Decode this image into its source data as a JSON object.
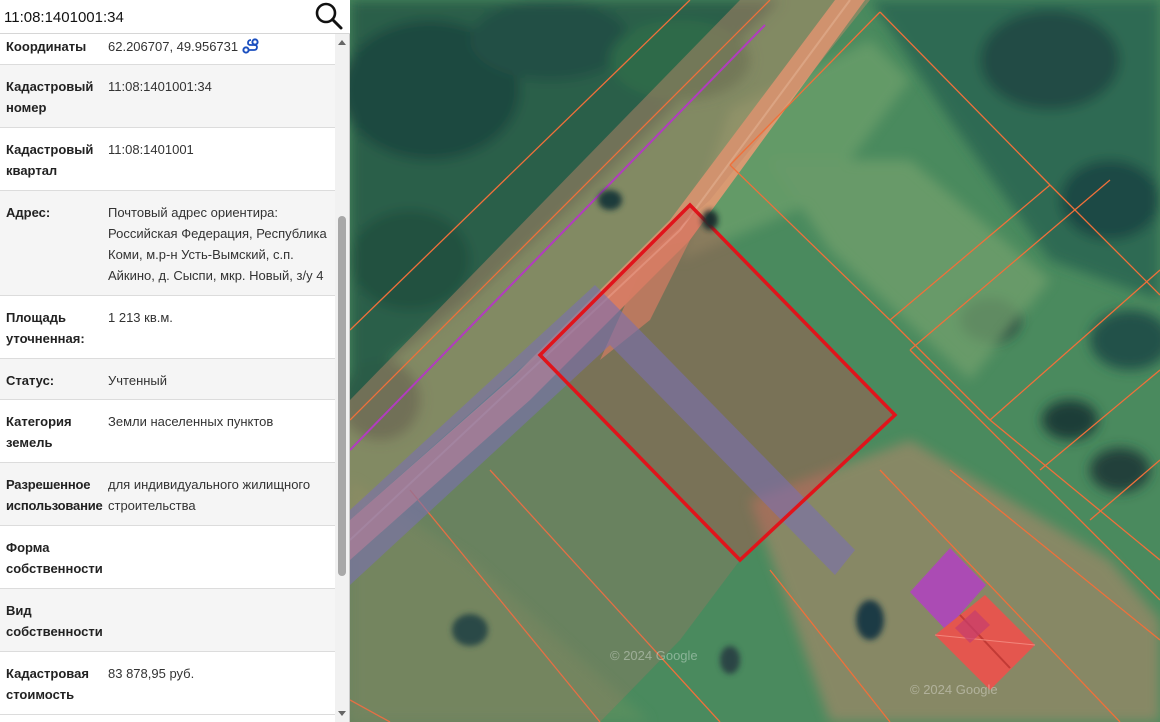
{
  "search": {
    "value": "11:08:1401001:34",
    "icon": "search-icon"
  },
  "info": {
    "rows": [
      {
        "label": "Координаты",
        "value": "62.206707, 49.956731",
        "has_route_icon": true
      },
      {
        "label": "Кадастровый номер",
        "value": "11:08:1401001:34"
      },
      {
        "label": "Кадастровый квартал",
        "value": "11:08:1401001"
      },
      {
        "label": "Адрес:",
        "value": "Почтовый адрес ориентира: Российская Федерация, Республика Коми, м.р-н Усть-Вымский, с.п. Айкино, д. Сыспи, мкр. Новый, з/у 4"
      },
      {
        "label": "Площадь уточненная:",
        "value": "1 213 кв.м."
      },
      {
        "label": "Статус:",
        "value": "Учтенный"
      },
      {
        "label": "Категория земель",
        "value": "Земли населенных пунктов"
      },
      {
        "label": "Разрешенное использование",
        "value": "для индивидуального жилищного строительства"
      },
      {
        "label": "Форма собственности",
        "value": ""
      },
      {
        "label": "Вид собственности",
        "value": ""
      },
      {
        "label": "Кадастровая стоимость",
        "value": "83 878,95 руб."
      }
    ]
  },
  "map": {
    "watermark_1": "© 2024 Google",
    "watermark_2": "© 2024 Google",
    "selected_parcel_color": "#e0141b",
    "parcel_line_color": "#f0703a",
    "road_color": "#d89a72"
  }
}
